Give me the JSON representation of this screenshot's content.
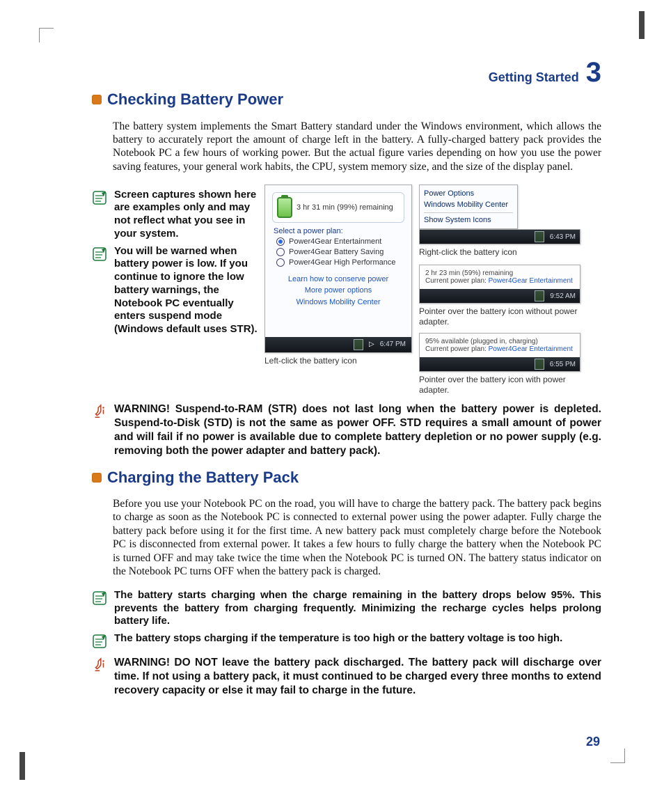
{
  "header": {
    "section_label": "Getting Started",
    "chapter_number": "3"
  },
  "section1": {
    "title": "Checking Battery Power",
    "body": "The battery system implements the Smart Battery standard under the Windows environment, which allows the battery to accurately report the amount of charge left in the battery. A fully-charged battery pack provides the Notebook PC a few hours of working power. But the actual figure varies depending on how you use the power saving features, your general work habits, the CPU, system memory size, and the size of the display panel."
  },
  "notes_left": [
    "Screen captures shown here are examples only and may not reflect what you see in your system.",
    "You will be warned when battery power is low. If you continue to ignore the low battery warnings, the Notebook PC eventually enters suspend mode (Windows default uses STR)."
  ],
  "screenshot_center": {
    "bubble_text": "3 hr 31 min (99%) remaining",
    "select_label": "Select a power plan:",
    "plans": [
      {
        "label": "Power4Gear Entertainment",
        "selected": true
      },
      {
        "label": "Power4Gear Battery Saving",
        "selected": false
      },
      {
        "label": "Power4Gear High Performance",
        "selected": false
      }
    ],
    "links": [
      "Learn how to conserve power",
      "More power options",
      "Windows Mobility Center"
    ],
    "tray_time": "6:47 PM",
    "caption": "Left-click the battery icon"
  },
  "screenshot_right1": {
    "menu": [
      "Power Options",
      "Windows Mobility Center",
      "Show System Icons"
    ],
    "tray_time": "6:43 PM",
    "caption": "Right-click the battery icon"
  },
  "screenshot_right2": {
    "bubble_text": "2 hr 23 min (59%) remaining",
    "plan_label": "Current power plan:",
    "plan_value": "Power4Gear Entertainment",
    "tray_time": "9:52 AM",
    "caption": "Pointer over the battery icon without power adapter."
  },
  "screenshot_right3": {
    "bubble_text": "95% available (plugged in, charging)",
    "plan_label": "Current power plan:",
    "plan_value": "Power4Gear Entertainment",
    "tray_time": "6:55 PM",
    "caption": "Pointer over the battery icon with power adapter."
  },
  "warning1": "WARNING!  Suspend-to-RAM (STR) does not last long when the battery power is depleted. Suspend-to-Disk (STD) is not the same as power OFF. STD requires a small amount of power and will fail if no power is available due to complete battery depletion or no power supply (e.g. removing both the power adapter and battery pack).",
  "section2": {
    "title": "Charging the Battery Pack",
    "body": "Before you use your Notebook PC on the road, you will have to charge the battery pack. The battery pack begins to charge as soon as the Notebook PC is connected to external power using the power adapter. Fully charge the battery pack before using it for the first time. A new battery pack must completely charge before the Notebook PC is disconnected from external power. It takes a few hours to fully charge the battery when the Notebook PC is turned OFF and may take twice the time when the Notebook PC is turned ON. The battery status indicator on the Notebook PC turns OFF when the battery pack is charged."
  },
  "notes_bottom": [
    "The battery starts charging when the charge remaining in the battery drops below 95%. This prevents the battery from charging frequently. Minimizing the recharge cycles helps prolong battery life.",
    "The battery stops charging if the temperature is too high or the battery voltage is too high."
  ],
  "warning2": "WARNING!  DO NOT leave the battery pack discharged. The battery pack will discharge over time. If not using a battery pack, it must continued to be charged every three months to extend recovery capacity or else it may fail to charge in the future.",
  "page_number": "29"
}
